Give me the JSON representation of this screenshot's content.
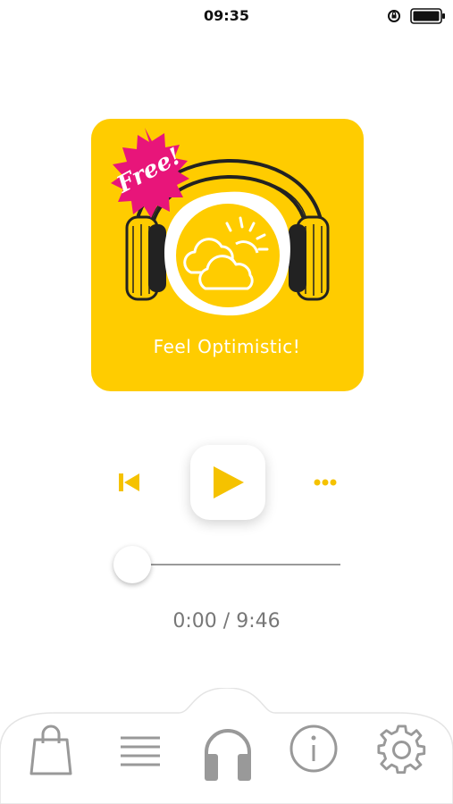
{
  "status_bar": {
    "time": "09:35",
    "icons": [
      "orientation-lock-icon",
      "battery-icon"
    ]
  },
  "album": {
    "badge": "Free!",
    "title": "Feel Optimistic!",
    "colors": {
      "background": "#ffcc00",
      "badge": "#e8157a",
      "art": "#ffffff",
      "outline": "#222222"
    }
  },
  "player": {
    "buttons": [
      "previous-track-icon",
      "play-icon",
      "more-options-icon"
    ],
    "progress_fraction": 0,
    "time_label": "0:00 / 9:46",
    "accent": "#f5c200"
  },
  "tabs": [
    {
      "name": "shop",
      "icon": "shopping-bag-icon",
      "active": false
    },
    {
      "name": "playlist",
      "icon": "list-icon",
      "active": false
    },
    {
      "name": "player",
      "icon": "headphones-icon",
      "active": true
    },
    {
      "name": "info",
      "icon": "info-icon",
      "active": false
    },
    {
      "name": "settings",
      "icon": "gear-icon",
      "active": false
    }
  ]
}
